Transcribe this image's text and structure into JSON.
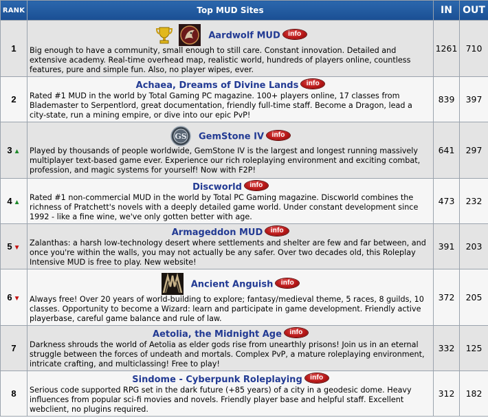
{
  "header": {
    "rank": "RANK",
    "title": "Top MUD Sites",
    "in": "IN",
    "out": "OUT"
  },
  "rows": [
    {
      "rank": "1",
      "trend": "",
      "name": "Aardwolf MUD",
      "info": "info",
      "desc": "Big enough to have a community, small enough to still care. Constant innovation. Detailed and extensive academy. Real-time overhead map, realistic world, hundreds of players online, countless features, pure and simple fun. Also, no player wipes, ever.",
      "in": "1261",
      "out": "710",
      "icons": [
        "trophy-icon",
        "aardwolf-logo"
      ]
    },
    {
      "rank": "2",
      "trend": "",
      "name": "Achaea, Dreams of Divine Lands",
      "info": "info",
      "desc": "Rated #1 MUD in the world by Total Gaming PC magazine. 100+ players online, 17 classes from Blademaster to Serpentlord, great documentation, friendly full-time staff. Become a Dragon, lead a city-state, run a mining empire, or dive into our epic PvP!",
      "in": "839",
      "out": "397",
      "icons": []
    },
    {
      "rank": "3",
      "trend": "▲",
      "name": "GemStone IV",
      "info": "info",
      "desc": "Played by thousands of people worldwide, GemStone IV is the largest and longest running massively multiplayer text-based game ever. Experience our rich roleplaying environment and exciting combat, profession, and magic systems for yourself! Now with F2P!",
      "in": "641",
      "out": "297",
      "icons": [
        "gemstone-logo"
      ]
    },
    {
      "rank": "4",
      "trend": "▲",
      "name": "Discworld",
      "info": "info",
      "desc": "Rated #1 non-commercial MUD in the world by Total PC Gaming magazine. Discworld combines the richness of Pratchett's novels with a deeply detailed game world. Under constant development since 1992 - like a fine wine, we've only gotten better with age.",
      "in": "473",
      "out": "232",
      "icons": []
    },
    {
      "rank": "5",
      "trend": "▼",
      "name": "Armageddon MUD",
      "info": "info",
      "desc": "Zalanthas: a harsh low-technology desert where settlements and shelter are few and far between, and once you're within the walls, you may not actually be any safer. Over two decades old, this Roleplay Intensive MUD is free to play. New website!",
      "in": "391",
      "out": "203",
      "icons": []
    },
    {
      "rank": "6",
      "trend": "▼",
      "name": "Ancient Anguish",
      "info": "info",
      "desc": "Always free! Over 20 years of world-building to explore; fantasy/medieval theme, 5 races, 8 guilds, 10 classes. Opportunity to become a Wizard: learn and participate in game development. Friendly active playerbase, careful game balance and rule of law.",
      "in": "372",
      "out": "205",
      "icons": [
        "ancient-anguish-logo"
      ]
    },
    {
      "rank": "7",
      "trend": "",
      "name": "Aetolia, the Midnight Age",
      "info": "info",
      "desc": "Darkness shrouds the world of Aetolia as elder gods rise from unearthly prisons! Join us in an eternal struggle between the forces of undeath and mortals. Complex PvP, a mature roleplaying environment, intricate crafting, and multiclassing! Free to play!",
      "in": "332",
      "out": "125",
      "icons": []
    },
    {
      "rank": "8",
      "trend": "",
      "name": "Sindome - Cyberpunk Roleplaying",
      "info": "info",
      "desc": "Serious code supported RPG set in the dark future (+85 years) of a city in a geodesic dome. Heavy influences from popular sci-fi movies and novels. Friendly player base and helpful staff. Excellent webclient, no plugins required.",
      "in": "312",
      "out": "182",
      "icons": []
    }
  ],
  "colors": {
    "header": "#1f5aa0",
    "link": "#223a93",
    "row_odd": "#e4e4e4",
    "row_even": "#f6f6f6",
    "up": "#1f8a2b",
    "down": "#c40f0f",
    "info_badge": "#b81818"
  }
}
